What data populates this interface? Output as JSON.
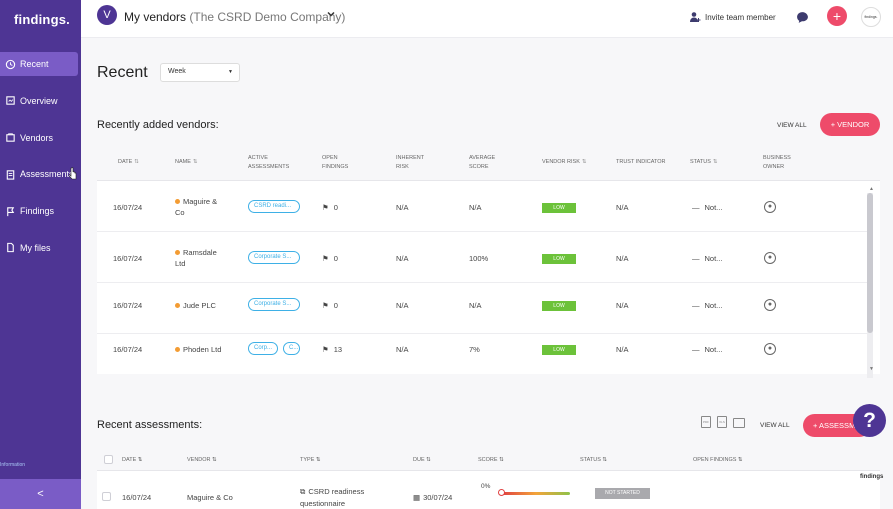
{
  "app": {
    "logo_text": "findings.",
    "footer_text": "findings"
  },
  "sidebar": {
    "items": [
      {
        "label": "Recent",
        "icon": "recent-icon",
        "active": true
      },
      {
        "label": "Overview",
        "icon": "overview-icon",
        "active": false
      },
      {
        "label": "Vendors",
        "icon": "vendors-icon",
        "active": false
      },
      {
        "label": "Assessments",
        "icon": "assessments-icon",
        "active": false
      },
      {
        "label": "Findings",
        "icon": "flag-icon",
        "active": false
      },
      {
        "label": "My files",
        "icon": "file-icon",
        "active": false
      }
    ],
    "footer_small": "Information",
    "collapse_glyph": "<"
  },
  "topbar": {
    "avatar_letter": "V",
    "title": "My vendors",
    "company": "(The CSRD Demo Company)",
    "invite_label": "Invite team member",
    "plus_glyph": "+",
    "profile_text": "findings."
  },
  "page": {
    "title": "Recent",
    "period_select": "Week"
  },
  "vendors_section": {
    "title": "Recently added vendors:",
    "view_all": "VIEW ALL",
    "add_button": "+ VENDOR",
    "columns": [
      "DATE",
      "NAME",
      "ACTIVE ASSESSMENTS",
      "OPEN FINDINGS",
      "INHERENT RISK",
      "AVERAGE SCORE",
      "VENDOR RISK",
      "TRUST INDICATOR",
      "STATUS",
      "BUSINESS OWNER"
    ],
    "rows": [
      {
        "date": "16/07/24",
        "name": "Maguire & Co",
        "assessments": [
          "CSRD readi..."
        ],
        "open_findings": "0",
        "inherent_risk": "N/A",
        "average_score": "N/A",
        "vendor_risk": "LOW",
        "trust_indicator": "N/A",
        "status": "Not..."
      },
      {
        "date": "16/07/24",
        "name": "Ramsdale Ltd",
        "assessments": [
          "Corporate S..."
        ],
        "open_findings": "0",
        "inherent_risk": "N/A",
        "average_score": "100%",
        "vendor_risk": "LOW",
        "trust_indicator": "N/A",
        "status": "Not..."
      },
      {
        "date": "16/07/24",
        "name": "Jude PLC",
        "assessments": [
          "Corporate S..."
        ],
        "open_findings": "0",
        "inherent_risk": "N/A",
        "average_score": "N/A",
        "vendor_risk": "LOW",
        "trust_indicator": "N/A",
        "status": "Not..."
      },
      {
        "date": "16/07/24",
        "name": "Phoden Ltd",
        "assessments": [
          "Corp...",
          "C..."
        ],
        "open_findings": "13",
        "inherent_risk": "N/A",
        "average_score": "7%",
        "vendor_risk": "LOW",
        "trust_indicator": "N/A",
        "status": "Not..."
      }
    ]
  },
  "assessments_section": {
    "title": "Recent assessments:",
    "view_all": "VIEW ALL",
    "add_button": "+ ASSESSM...",
    "columns": [
      "DATE",
      "VENDOR",
      "TYPE",
      "DUE",
      "SCORE",
      "STATUS",
      "OPEN FINDINGS"
    ],
    "rows": [
      {
        "date": "16/07/24",
        "vendor": "Maguire & Co",
        "type": "CSRD readiness questionnaire",
        "due": "30/07/24",
        "score": "0%",
        "status": "NOT STARTED"
      }
    ]
  },
  "help_glyph": "?",
  "colors": {
    "sidebar": "#4e3594",
    "accent": "#ee4b6a",
    "low": "#6cc23a",
    "tag": "#3eb0e6"
  }
}
